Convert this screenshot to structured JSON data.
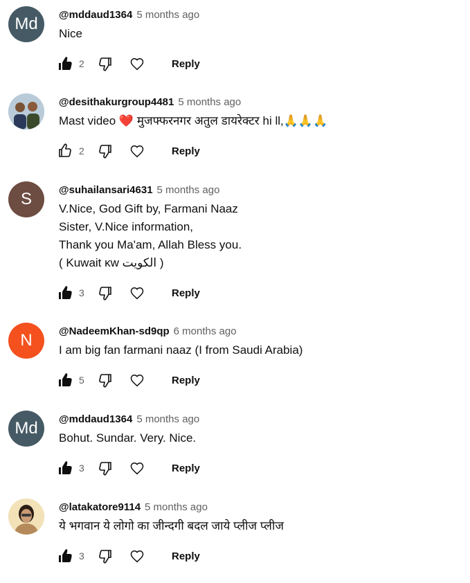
{
  "comments": [
    {
      "author": "@mddaud1364",
      "time": "5 months ago",
      "text": "Nice",
      "likes": "2",
      "liked": true,
      "avatar_text": "Md",
      "avatar_color": "#455a64",
      "reply_label": "Reply"
    },
    {
      "author": "@desithakurgroup4481",
      "time": "5 months ago",
      "text": "Mast video ❤️ मुजफ्फरनगर अतुल डायरेक्टर hi ll,🙏🙏🙏",
      "likes": "2",
      "liked": false,
      "avatar_text": "",
      "avatar_color": "#3a5a7a",
      "reply_label": "Reply"
    },
    {
      "author": "@suhailansari4631",
      "time": "5 months ago",
      "text": "V.Nice, God Gift by, Farmani Naaz\nSister, V.Nice information,\nThank you Ma'am, Allah Bless you.\n( Kuwait ĸw الكويت )",
      "likes": "3",
      "liked": true,
      "avatar_text": "S",
      "avatar_color": "#6d4c41",
      "reply_label": "Reply"
    },
    {
      "author": "@NadeemKhan-sd9qp",
      "time": "6 months ago",
      "text": "I am big fan farmani naaz (I from Saudi Arabia)",
      "likes": "5",
      "liked": true,
      "avatar_text": "N",
      "avatar_color": "#f4511e",
      "reply_label": "Reply"
    },
    {
      "author": "@mddaud1364",
      "time": "5 months ago",
      "text": "Bohut. Sundar. Very. Nice.",
      "likes": "3",
      "liked": true,
      "avatar_text": "Md",
      "avatar_color": "#455a64",
      "reply_label": "Reply"
    },
    {
      "author": "@latakatore9114",
      "time": "5 months ago",
      "text": "ये भगवान ये लोगो का जीन्दगी बदल जाये प्लीज प्लीज",
      "likes": "3",
      "liked": true,
      "avatar_text": "",
      "avatar_color": "#e8c9a0",
      "reply_label": "Reply"
    }
  ]
}
